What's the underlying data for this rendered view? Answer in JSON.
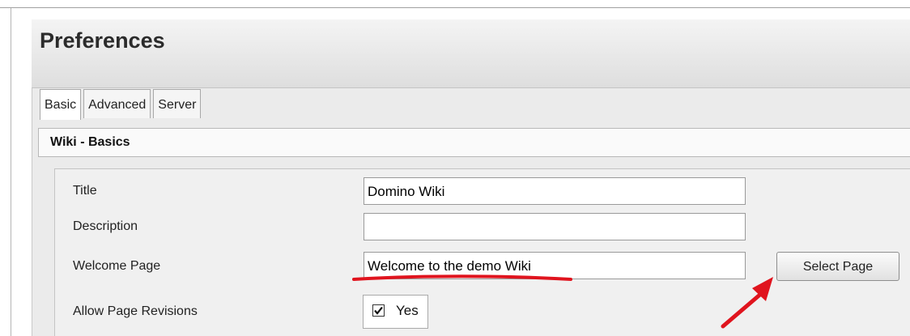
{
  "preferences": {
    "title": "Preferences",
    "tabs": [
      {
        "label": "Basic",
        "active": true
      },
      {
        "label": "Advanced",
        "active": false
      },
      {
        "label": "Server",
        "active": false
      }
    ],
    "section_title": "Wiki - Basics",
    "fields": {
      "title": {
        "label": "Title",
        "value": "Domino Wiki"
      },
      "description": {
        "label": "Description",
        "value": ""
      },
      "welcome_page": {
        "label": "Welcome Page",
        "value": "Welcome to the demo Wiki",
        "select_button": "Select Page"
      },
      "allow_revisions": {
        "label": "Allow Page Revisions",
        "checked": true,
        "option_label": "Yes"
      }
    }
  },
  "annotation": {
    "underline_color": "#e0141e",
    "arrow_color": "#e0141e"
  },
  "icons": {
    "checkmark": "checkmark-icon",
    "arrow": "red-arrow-icon"
  }
}
